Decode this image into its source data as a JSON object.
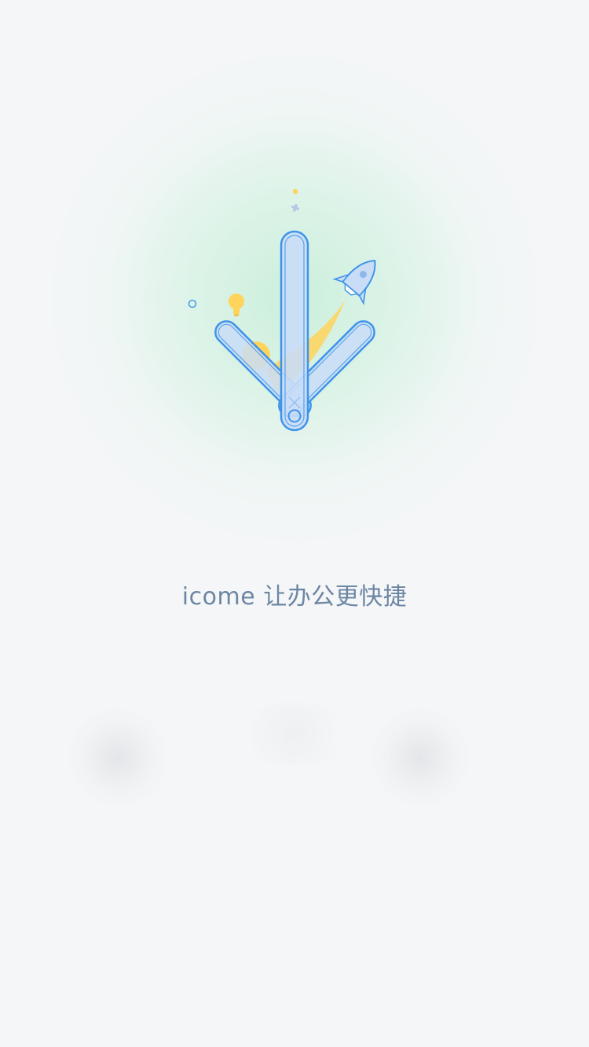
{
  "splash": {
    "slogan": "icome 让办公更快捷"
  },
  "icons": {
    "logo": "download-arrow-rocket-icon",
    "rocket": "rocket-icon",
    "bulb": "light-bulb-icon",
    "sparkle": "sparkle-icon"
  },
  "colors": {
    "background": "#f5f6f8",
    "glow": "#c4eed7",
    "arrow_fill": "#c9ddf7",
    "arrow_stroke": "#3f94ea",
    "accent_yellow": "#ffd45a",
    "slogan": "#6c86a3"
  }
}
